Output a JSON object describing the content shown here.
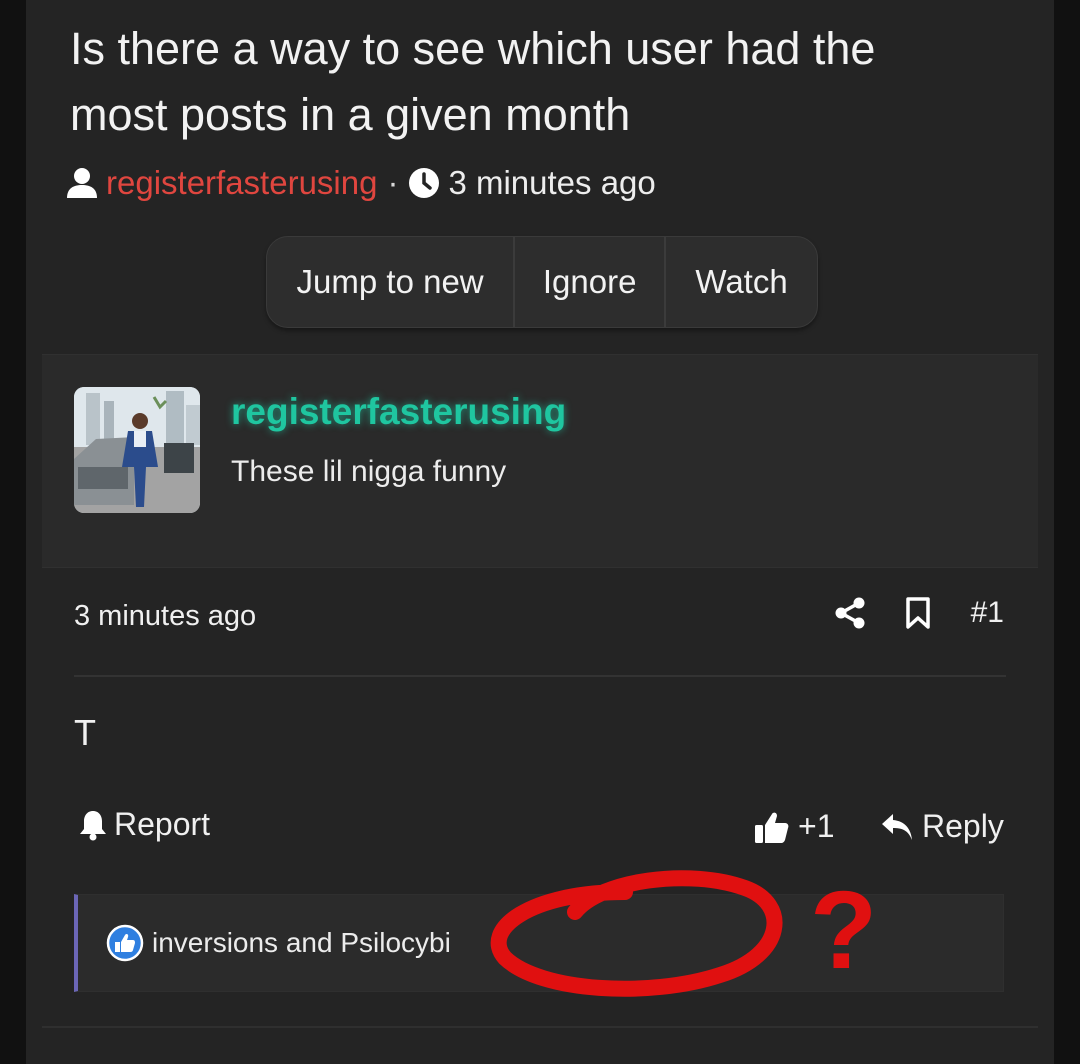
{
  "thread": {
    "title": "Is there a way to see which user had the most posts in a given month",
    "author": "registerfasterusing",
    "separator": "·",
    "time": "3 minutes ago"
  },
  "actions": {
    "jump": "Jump to new",
    "ignore": "Ignore",
    "watch": "Watch"
  },
  "author_card": {
    "name": "registerfasterusing",
    "quote": "These lil nigga funny"
  },
  "post": {
    "time": "3 minutes ago",
    "number": "#1",
    "body": "T",
    "report": "Report",
    "like_count": "+1",
    "reply": "Reply"
  },
  "reactions": {
    "text": "inversions and Psilocybi"
  },
  "annotation": {
    "mark": "?"
  },
  "colors": {
    "author": "#e0463f",
    "card_name": "#1fc6a0",
    "reaction_border": "#6b66b6",
    "scribble": "#e01010"
  },
  "icons": [
    "user-icon",
    "clock-icon",
    "share-icon",
    "bookmark-icon",
    "bell-icon",
    "thumbs-up-icon",
    "reply-icon",
    "like-reaction-icon"
  ]
}
